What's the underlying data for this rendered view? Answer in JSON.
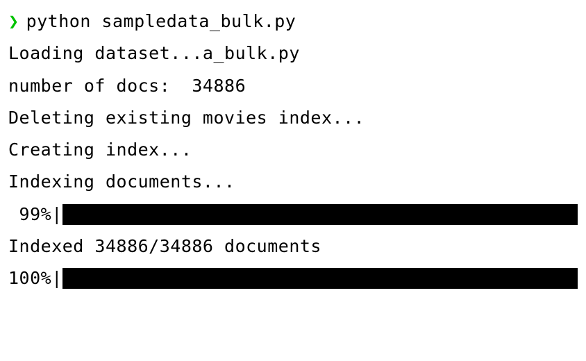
{
  "prompt": {
    "symbol": "❯",
    "command": "python sampledata_bulk.py"
  },
  "output": {
    "line1": "Loading dataset...a_bulk.py",
    "line2": "number of docs:  34886",
    "line3": "Deleting existing movies index...",
    "line4": "Creating index...",
    "line5": "Indexing documents...",
    "progress1_percent": " 99%|",
    "line6": "Indexed 34886/34886 documents",
    "progress2_percent": "100%|"
  }
}
